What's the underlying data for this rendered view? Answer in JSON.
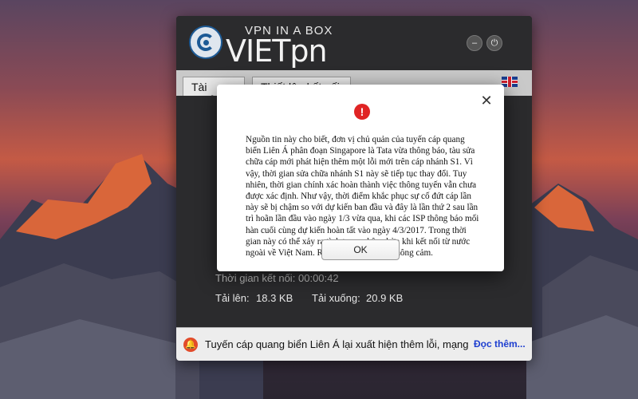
{
  "app": {
    "tagline": "VPN IN A BOX",
    "brand": "VIETpn",
    "tabs": [
      "Tài khoản",
      "Thiết lập kết nối"
    ],
    "stats": {
      "connected_time_label": "Thời gian kết nối:",
      "connected_time_value": "00:00:42",
      "upload_label": "Tải lên:",
      "upload_value": "18.3 KB",
      "download_label": "Tải xuống:",
      "download_value": "20.9 KB"
    },
    "notice": {
      "text": "Tuyến cáp quang biển Liên Á lại xuất hiện thêm lỗi, mạng tiếp t",
      "link": "Đọc thêm..."
    }
  },
  "modal": {
    "message": "Nguồn tin này cho biết, đơn vị chủ quản của tuyến cáp quang biển Liên Á phân đoạn Singapore là Tata vừa thông báo, tàu sửa chữa cáp mới phát hiện thêm một lỗi mới trên cáp nhánh S1. Vì vậy, thời gian sửa chữa nhánh S1 này sẽ tiếp tục thay đổi. Tuy nhiên, thời gian chính xác hoàn thành việc thông tuyến vẫn chưa được xác định. Như vậy, thời điểm khắc phục sự cố đứt cáp lần này sẽ bị chậm so với dự kiến ban đầu và đây là lần thứ 2 sau lần trì hoãn lần đầu vào ngày 1/3 vừa qua, khi các ISP thông báo mối hàn cuối cùng dự kiến hoàn tất vào ngày 4/3/2017. Trong thời gian này có thể xảy ra tình trạng chập chờn khi kết nối từ nước ngoài về Việt Nam. Rất mong quý khách thông cảm.",
    "ok_label": "OK"
  },
  "colors": {
    "accent": "#1d5a95",
    "alert": "#e02424",
    "link": "#1e3fd0"
  }
}
